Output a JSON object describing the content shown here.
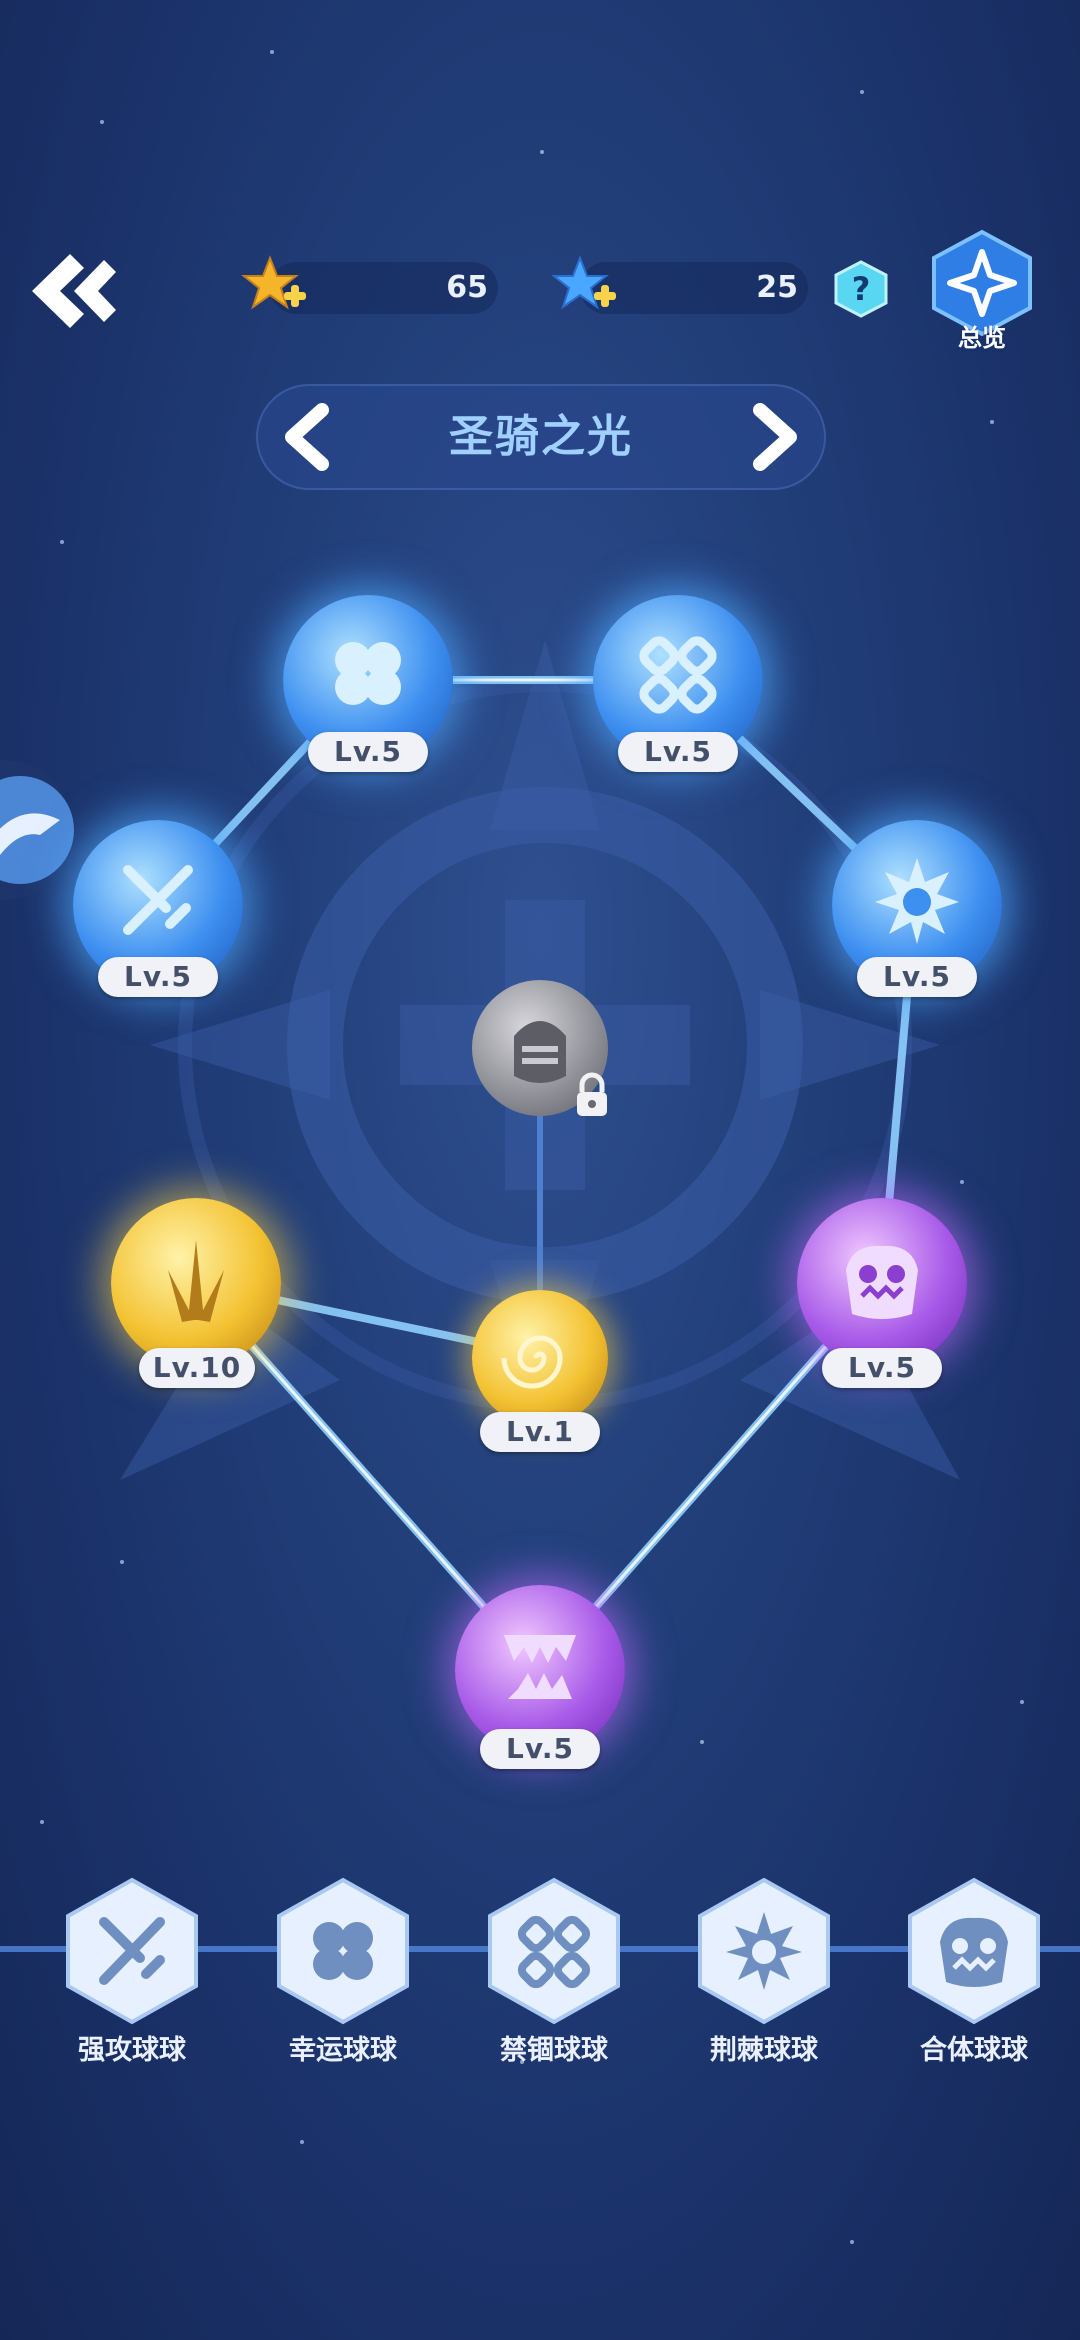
{
  "header": {
    "resources": [
      {
        "name": "gold-star-icon",
        "value": "65",
        "color": "#f5b52b"
      },
      {
        "name": "blue-star-icon",
        "value": "25",
        "color": "#4aa7ff"
      }
    ],
    "help_label": "?",
    "overview_label": "总览"
  },
  "set_selector": {
    "title": "圣骑之光"
  },
  "nodes": [
    {
      "icon": "clover-icon",
      "level": "Lv.5",
      "color": "blue"
    },
    {
      "icon": "chain-icon",
      "level": "Lv.5",
      "color": "blue"
    },
    {
      "icon": "crossed-swords-icon",
      "level": "Lv.5",
      "color": "blue"
    },
    {
      "icon": "thorn-icon",
      "level": "Lv.5",
      "color": "blue"
    },
    {
      "icon": "knight-helmet-icon",
      "level": "",
      "color": "gray",
      "locked": true
    },
    {
      "icon": "burst-icon",
      "level": "Lv.10",
      "color": "gold"
    },
    {
      "icon": "swirl-icon",
      "level": "Lv.1",
      "color": "gold"
    },
    {
      "icon": "monster-face-icon",
      "level": "Lv.5",
      "color": "purple"
    },
    {
      "icon": "fangs-icon",
      "level": "Lv.5",
      "color": "purple"
    }
  ],
  "categories": [
    {
      "icon": "crossed-swords-icon",
      "label": "强攻球球"
    },
    {
      "icon": "clover-icon",
      "label": "幸运球球"
    },
    {
      "icon": "chain-icon",
      "label": "禁锢球球"
    },
    {
      "icon": "thorn-icon",
      "label": "荆棘球球"
    },
    {
      "icon": "monster-face-icon",
      "label": "合体球球"
    }
  ],
  "colors": {
    "blue_orb": "#3d8ff0",
    "gold_orb": "#f3c232",
    "purple_orb": "#a85be8",
    "link": "#8fd0ff"
  }
}
